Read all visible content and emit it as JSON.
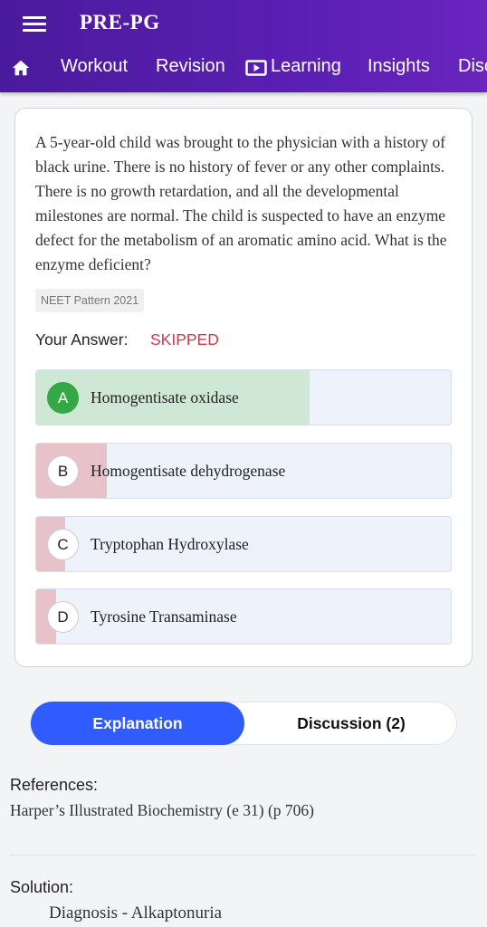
{
  "header": {
    "app_title": "PRE-PG",
    "menu_icon": "hamburger-menu-icon",
    "nav": {
      "home_icon": "home-icon",
      "items": [
        "Workout",
        "Revision",
        "Learning",
        "Insights",
        "Disc"
      ],
      "learning_icon": "play-screen-icon"
    },
    "colors": {
      "gradient_start": "#4a1a9c",
      "gradient_end": "#6a24bf"
    }
  },
  "question": {
    "text": "A 5-year-old child was brought to the physician with a history of black urine. There is no history of fever or any other complaints. There is no growth retardation, and all the developmental milestones are normal. The child is suspected to have an enzyme defect for the metabolism of an aromatic amino acid. What is the enzyme deficient?",
    "tag": "NEET Pattern 2021",
    "your_answer_label": "Your Answer:",
    "your_answer_value": "SKIPPED",
    "options": [
      {
        "letter": "A",
        "text": "Homogentisate oxidase",
        "correct": true,
        "share": 0.66
      },
      {
        "letter": "B",
        "text": "Homogentisate dehydrogenase",
        "correct": false,
        "share": 0.17
      },
      {
        "letter": "C",
        "text": "Tryptophan Hydroxylase",
        "correct": false,
        "share": 0.07
      },
      {
        "letter": "D",
        "text": "Tyrosine Transaminase",
        "correct": false,
        "share": 0.05
      }
    ],
    "colors": {
      "correct": "#33a845",
      "correct_fill": "#cfe7d5",
      "wrong_fill": "#e8c2c9",
      "skipped": "#d9364b"
    }
  },
  "tabs": {
    "explanation": "Explanation",
    "discussion": "Discussion (2)",
    "active_color": "#2f5bff"
  },
  "explanation": {
    "references_label": "References:",
    "references_value": "Harper’s Illustrated Biochemistry (e 31) (p 706)",
    "solution_label": "Solution:",
    "solution_value": "Diagnosis - Alkaptonuria"
  }
}
